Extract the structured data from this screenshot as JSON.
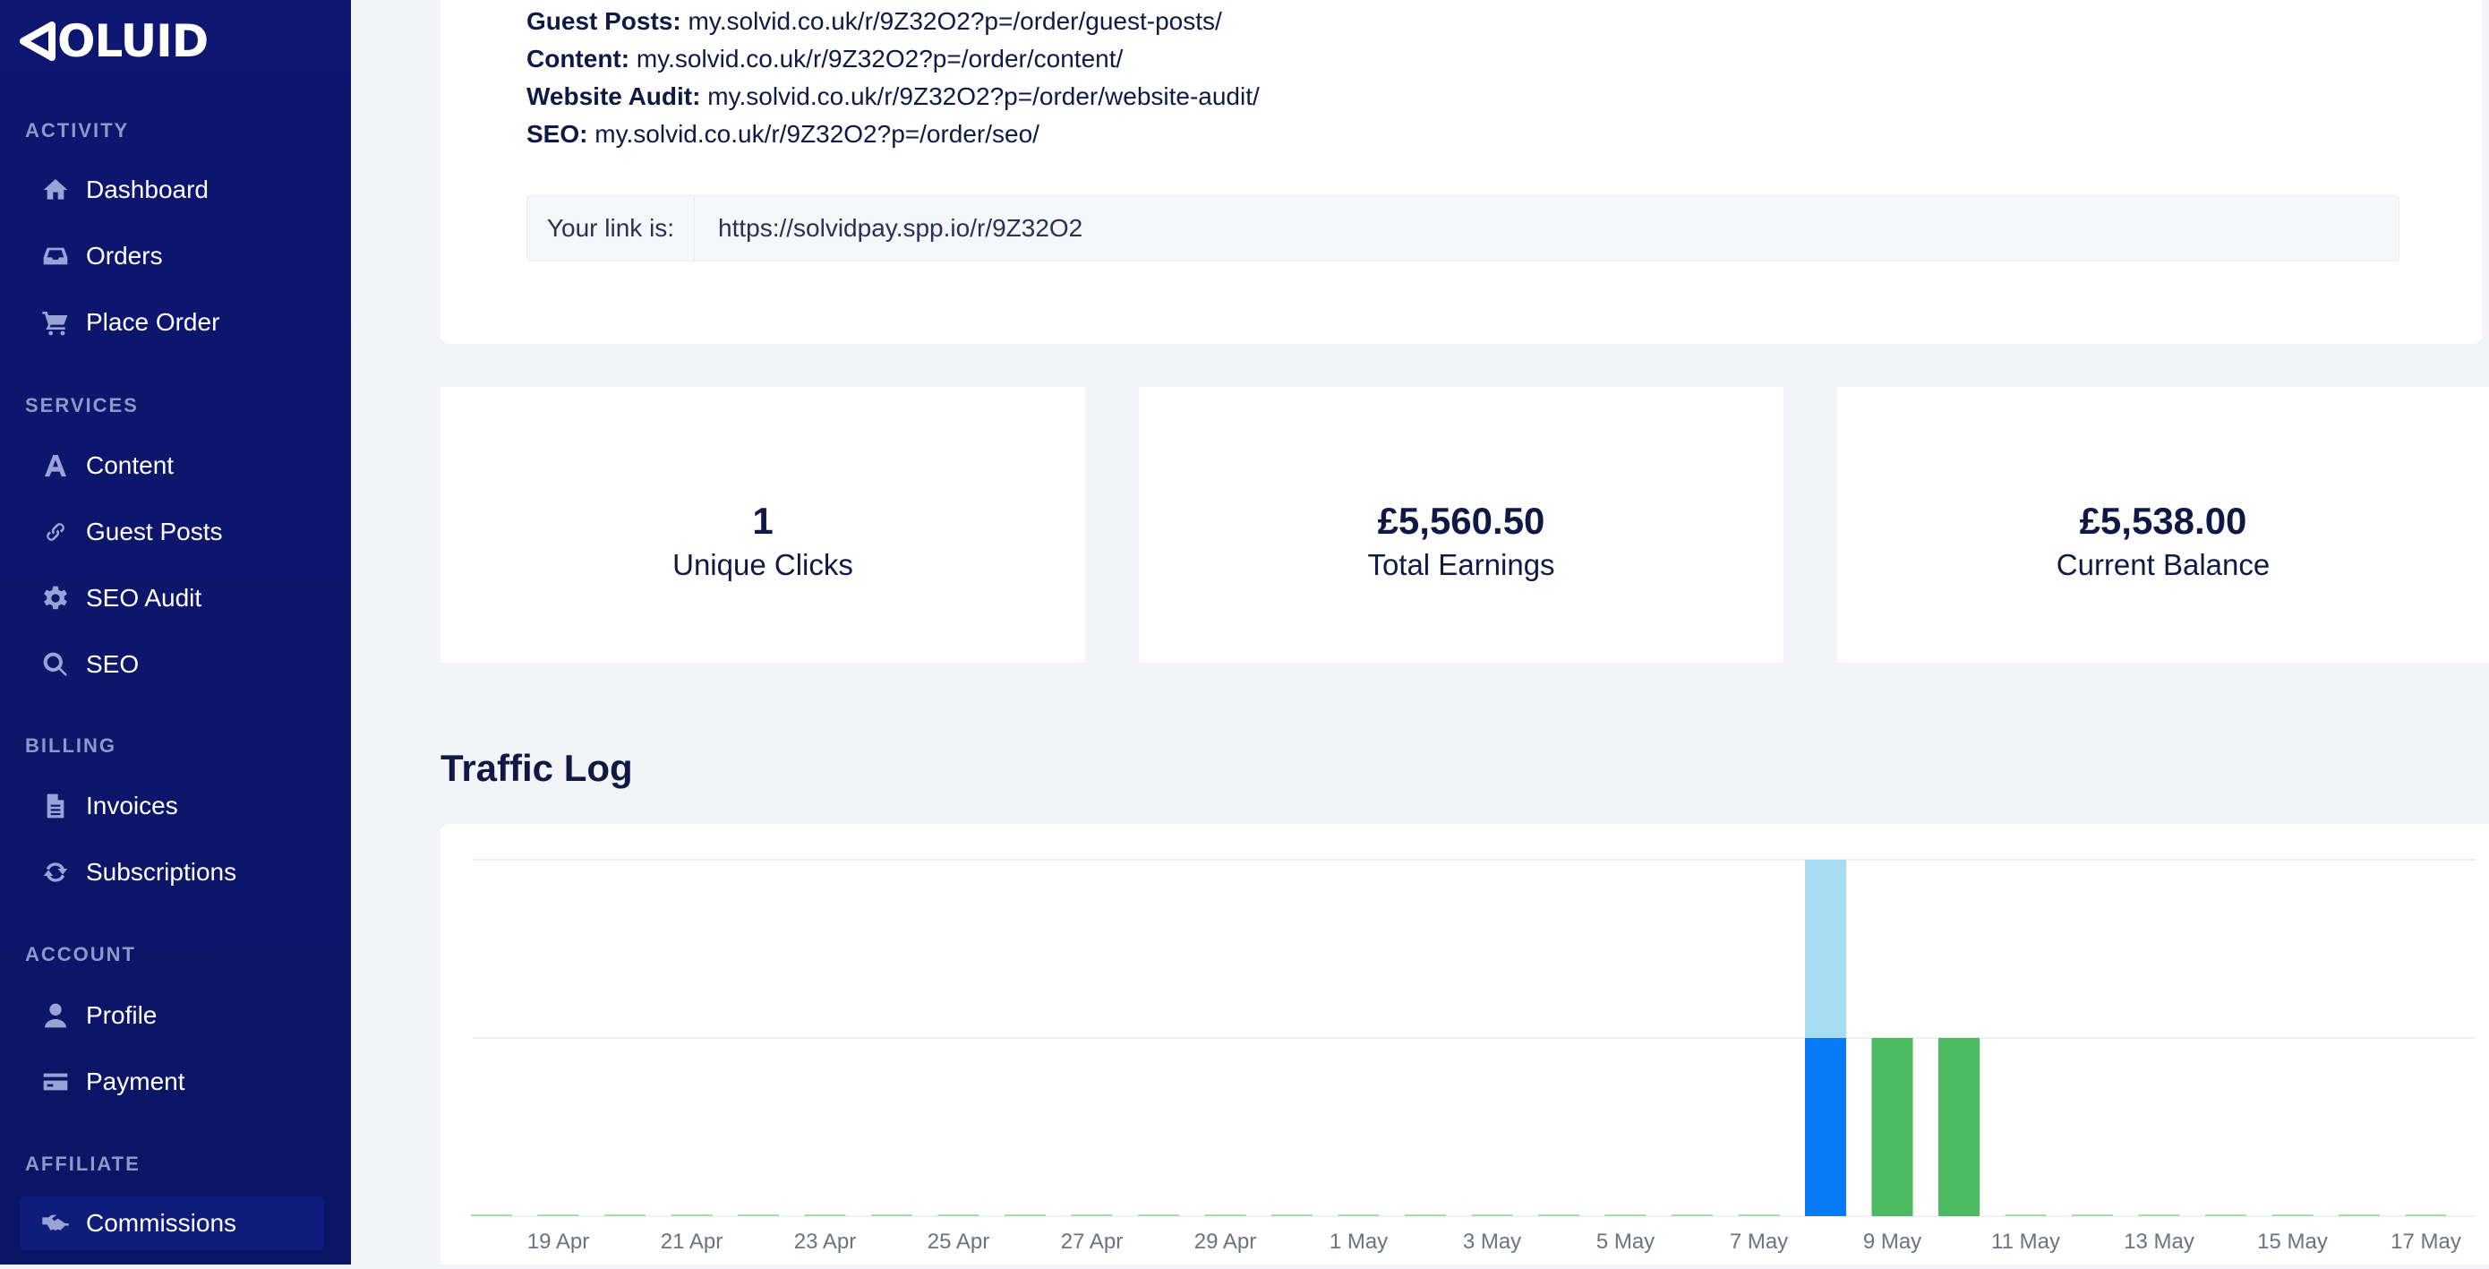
{
  "brand": {
    "name": "OLUID"
  },
  "sidebar": {
    "sections": [
      {
        "label": "ACTIVITY"
      },
      {
        "label": "SERVICES"
      },
      {
        "label": "BILLING"
      },
      {
        "label": "ACCOUNT"
      },
      {
        "label": "AFFILIATE"
      }
    ],
    "items": [
      {
        "label": "Dashboard",
        "icon": "home-icon"
      },
      {
        "label": "Orders",
        "icon": "inbox-icon"
      },
      {
        "label": "Place Order",
        "icon": "cart-icon"
      },
      {
        "label": "Content",
        "icon": "font-icon"
      },
      {
        "label": "Guest Posts",
        "icon": "link-icon"
      },
      {
        "label": "SEO Audit",
        "icon": "gear-icon"
      },
      {
        "label": "SEO",
        "icon": "search-icon"
      },
      {
        "label": "Invoices",
        "icon": "document-icon"
      },
      {
        "label": "Subscriptions",
        "icon": "refresh-icon"
      },
      {
        "label": "Profile",
        "icon": "user-icon"
      },
      {
        "label": "Payment",
        "icon": "credit-card-icon"
      },
      {
        "label": "Commissions",
        "icon": "handshake-icon",
        "active": true
      }
    ]
  },
  "referral_links": [
    {
      "label": "Guest Posts:",
      "url": "my.solvid.co.uk/r/9Z32O2?p=/order/guest-posts/"
    },
    {
      "label": "Content:",
      "url": "my.solvid.co.uk/r/9Z32O2?p=/order/content/"
    },
    {
      "label": "Website Audit:",
      "url": "my.solvid.co.uk/r/9Z32O2?p=/order/website-audit/"
    },
    {
      "label": "SEO:",
      "url": "my.solvid.co.uk/r/9Z32O2?p=/order/seo/"
    }
  ],
  "link_box": {
    "prefix": "Your link is:",
    "value": "https://solvidpay.spp.io/r/9Z32O2"
  },
  "stats": [
    {
      "value": "1",
      "label": "Unique Clicks"
    },
    {
      "value": "£5,560.50",
      "label": "Total Earnings"
    },
    {
      "value": "£5,538.00",
      "label": "Current Balance"
    }
  ],
  "traffic_log": {
    "title": "Traffic Log"
  },
  "colors": {
    "sidebar_bg": "#0c1570",
    "bar_blue": "#0b7af7",
    "bar_light_blue": "#a8dcf2",
    "bar_green": "#4cba60"
  },
  "chart_data": {
    "type": "bar",
    "stacked": true,
    "grid": true,
    "ylim": [
      0,
      2
    ],
    "tick_labels": [
      "19 Apr",
      "21 Apr",
      "23 Apr",
      "25 Apr",
      "27 Apr",
      "29 Apr",
      "1 May",
      "3 May",
      "5 May",
      "7 May",
      "9 May",
      "11 May",
      "13 May",
      "15 May",
      "17 May"
    ],
    "categories": [
      "18 Apr",
      "19 Apr",
      "20 Apr",
      "21 Apr",
      "22 Apr",
      "23 Apr",
      "24 Apr",
      "25 Apr",
      "26 Apr",
      "27 Apr",
      "28 Apr",
      "29 Apr",
      "30 Apr",
      "1 May",
      "2 May",
      "3 May",
      "4 May",
      "5 May",
      "6 May",
      "7 May",
      "8 May",
      "9 May",
      "10 May",
      "11 May",
      "12 May",
      "13 May",
      "14 May",
      "15 May",
      "16 May",
      "17 May"
    ],
    "series": [
      {
        "values": [
          0,
          0,
          0,
          0,
          0,
          0,
          0,
          0,
          0,
          0,
          0,
          0,
          0,
          0,
          0,
          0,
          0,
          0,
          0,
          0,
          1,
          0,
          0,
          0,
          0,
          0,
          0,
          0,
          0,
          0
        ],
        "color": "#0b7af7"
      },
      {
        "values": [
          0,
          0,
          0,
          0,
          0,
          0,
          0,
          0,
          0,
          0,
          0,
          0,
          0,
          0,
          0,
          0,
          0,
          0,
          0,
          0,
          1,
          0,
          0,
          0,
          0,
          0,
          0,
          0,
          0,
          0
        ],
        "color": "#a8dcf2"
      },
      {
        "values": [
          0,
          0,
          0,
          0,
          0,
          0,
          0,
          0,
          0,
          0,
          0,
          0,
          0,
          0,
          0,
          0,
          0,
          0,
          0,
          0,
          0,
          1,
          1,
          0,
          0,
          0,
          0,
          0,
          0,
          0
        ],
        "color": "#4cba60"
      }
    ]
  }
}
